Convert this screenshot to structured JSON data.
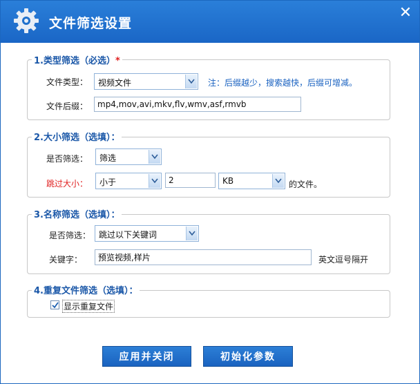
{
  "window": {
    "title": "文件筛选设置",
    "close_label": "✕"
  },
  "type_filter": {
    "legend": "1.类型筛选（必选）",
    "required_mark": "*",
    "file_type_label": "文件类型：",
    "file_type_value": "视频文件",
    "note": "注：后缀越少，搜索越快，后缀可增减。",
    "suffix_label": "文件后缀：",
    "suffix_value": "mp4,mov,avi,mkv,flv,wmv,asf,rmvb"
  },
  "size_filter": {
    "legend": "2.大小筛选（选填）：",
    "enable_label": "是否筛选：",
    "enable_value": "筛选",
    "skip_label": "跳过大小：",
    "comparator_value": "小于",
    "size_value": "2",
    "unit_value": "KB",
    "suffix_text": "的文件。"
  },
  "name_filter": {
    "legend": "3.名称筛选（选填）：",
    "enable_label": "是否筛选：",
    "enable_value": "跳过以下关键词",
    "keyword_label": "关键字：",
    "keyword_value": "预览视频,样片",
    "keyword_hint": "英文逗号隔开"
  },
  "dup_filter": {
    "legend": "4.重复文件筛选（选填）：",
    "show_dup_label": "显示重复文件",
    "show_dup_checked": true
  },
  "buttons": {
    "apply_label": "应用并关闭",
    "reset_label": "初始化参数"
  },
  "colors": {
    "accent": "#1a66c6",
    "legend_text": "#1a57a8",
    "required": "#e02020",
    "note": "#1a62c0"
  }
}
